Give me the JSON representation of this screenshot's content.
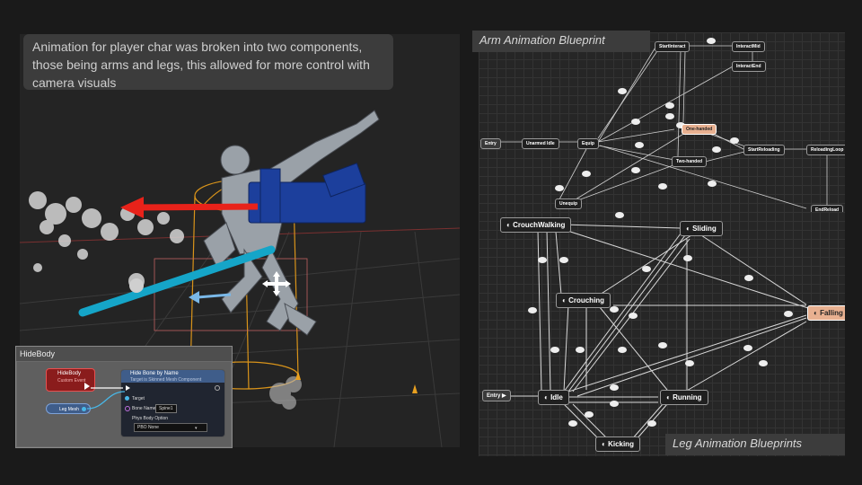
{
  "caption": "Animation for player char was broken into two components, those being arms and legs, this allowed  for more control with camera visuals",
  "hidebody": {
    "panel_title": "HideBody",
    "event_node": "HideBody",
    "event_sub": "Custom Event",
    "call_node": "Hide Bone by Name",
    "call_sub": "Target is Skinned Mesh Component",
    "pin_target": "Target",
    "pin_bone": "Bone Name",
    "bone_value": "Spine1",
    "pin_option": "Phys Body Option",
    "option_value": "PBO None",
    "var_node": "Leg Mesh"
  },
  "arm_blueprint": {
    "title": "Arm Animation Blueprint",
    "entry": "Entry",
    "states": [
      "Unarmed Idle",
      "Equip",
      "Unequip",
      "StartInteract",
      "InteractMid",
      "InteractEnd",
      "One-handed",
      "Two-handed",
      "StartReloading",
      "ReloadingLoop",
      "EndReload"
    ]
  },
  "leg_blueprint": {
    "title": "Leg Animation Blueprints",
    "entry": "Entry",
    "states": {
      "crouchwalking": "CrouchWalking",
      "sliding": "Sliding",
      "crouching": "Crouching",
      "falling": "Falling",
      "idle": "Idle",
      "running": "Running",
      "kicking": "Kicking"
    }
  },
  "colors": {
    "arrow_red": "#e8221a",
    "wire_orange": "#d8931a",
    "gun_blue": "#1c3f9c",
    "sword_cyan": "#15a5c8",
    "state_orange": "#e8b090"
  }
}
